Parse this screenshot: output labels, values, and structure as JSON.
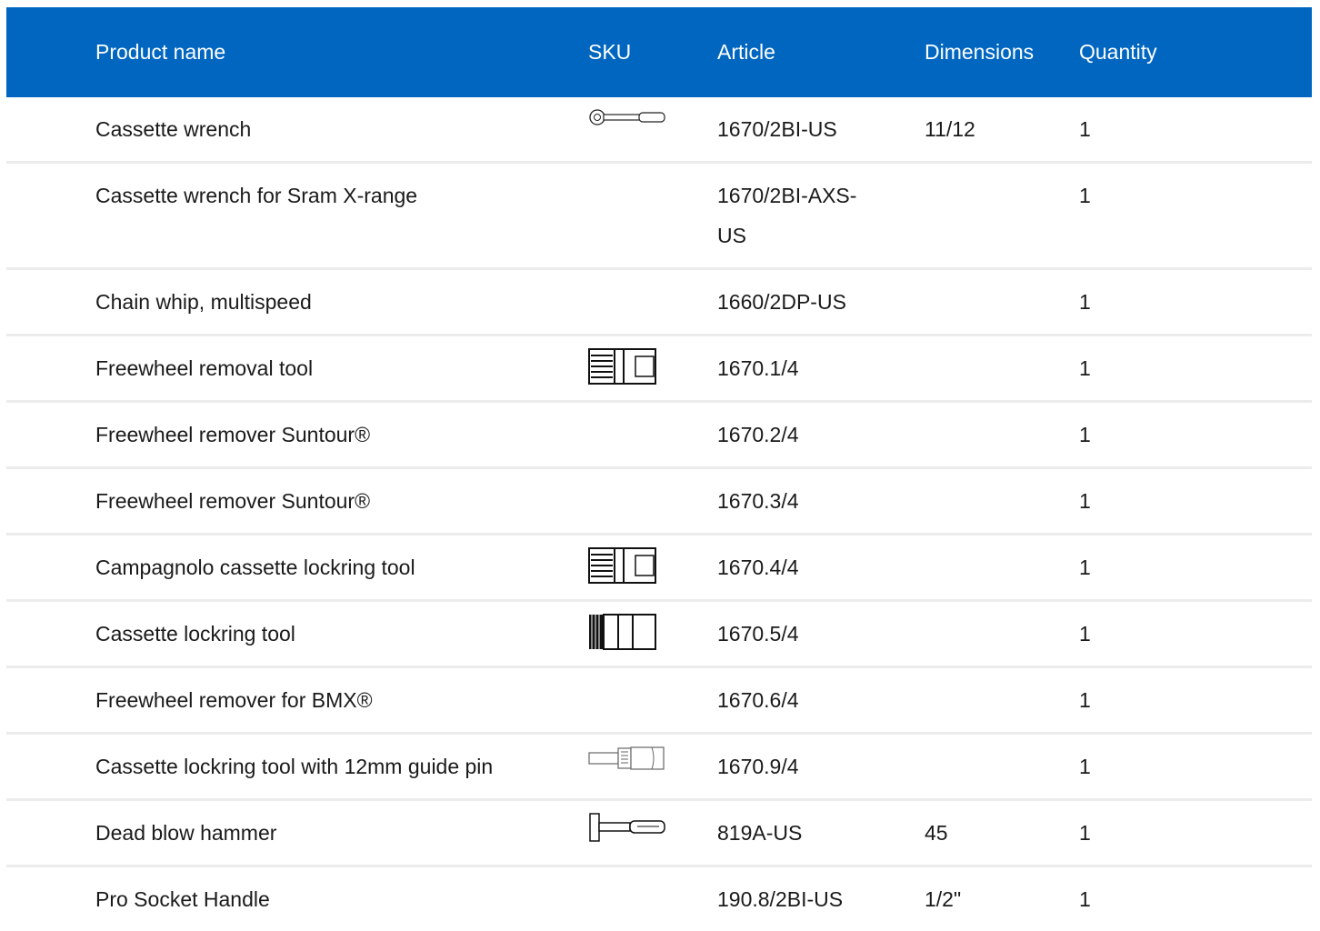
{
  "header": {
    "product_name": "Product name",
    "sku": "SKU",
    "article": "Article",
    "dimensions": "Dimensions",
    "quantity": "Quantity"
  },
  "colors": {
    "header_bg": "#0066c0",
    "header_text": "#ffffff",
    "row_divider": "#ececec"
  },
  "rows": [
    {
      "name": "Cassette wrench",
      "sku_icon": "wrench-icon",
      "article": "1670/2BI-US",
      "dimensions": "11/12",
      "quantity": "1"
    },
    {
      "name": "Cassette wrench for Sram X-range",
      "sku_icon": "",
      "article": "1670/2BI-AXS-",
      "article_line2": "US",
      "dimensions": "",
      "quantity": "1"
    },
    {
      "name": "Chain whip, multispeed",
      "sku_icon": "",
      "article": "1660/2DP-US",
      "dimensions": "",
      "quantity": "1"
    },
    {
      "name": "Freewheel removal tool",
      "sku_icon": "socket-tool-icon",
      "article": "1670.1/4",
      "dimensions": "",
      "quantity": "1"
    },
    {
      "name": "Freewheel remover Suntour®",
      "sku_icon": "",
      "article": "1670.2/4",
      "dimensions": "",
      "quantity": "1"
    },
    {
      "name": "Freewheel remover Suntour®",
      "sku_icon": "",
      "article": "1670.3/4",
      "dimensions": "",
      "quantity": "1"
    },
    {
      "name": "Campagnolo cassette lockring tool",
      "sku_icon": "socket-tool-icon",
      "article": "1670.4/4",
      "dimensions": "",
      "quantity": "1"
    },
    {
      "name": "Cassette lockring tool",
      "sku_icon": "splined-socket-icon",
      "article": "1670.5/4",
      "dimensions": "",
      "quantity": "1"
    },
    {
      "name": "Freewheel remover for BMX®",
      "sku_icon": "",
      "article": "1670.6/4",
      "dimensions": "",
      "quantity": "1"
    },
    {
      "name": "Cassette lockring tool with 12mm guide pin",
      "sku_icon": "guide-pin-tool-icon",
      "article": "1670.9/4",
      "dimensions": "",
      "quantity": "1"
    },
    {
      "name": "Dead blow hammer",
      "sku_icon": "hammer-icon",
      "article": "819A-US",
      "dimensions": "45",
      "quantity": "1"
    },
    {
      "name": "Pro Socket Handle",
      "sku_icon": "",
      "article": "190.8/2BI-US",
      "dimensions": "1/2\"",
      "quantity": "1"
    }
  ]
}
